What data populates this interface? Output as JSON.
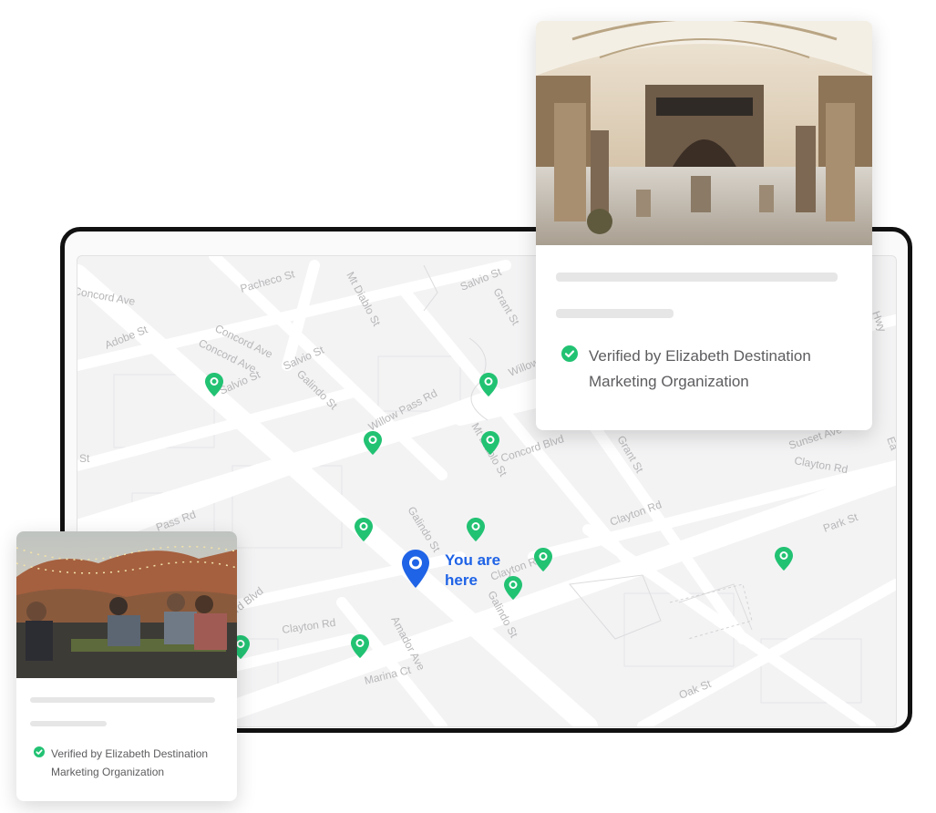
{
  "map": {
    "streets": [
      "Concord Ave",
      "Pacheco St",
      "Mt Diablo St",
      "Salvio St",
      "Grant St",
      "Adobe St",
      "Concord Ave",
      "Concord Ave",
      "Salvio St",
      "Salvio St",
      "Galindo St",
      "Willow Pass Rd",
      "Willow Pass Rd",
      "Mt Diablo St",
      "Concord Blvd",
      "Grant St",
      "Sunset Ave",
      "Clayton Rd",
      "Pass Rd",
      "Galindo St",
      "Clayton Rd",
      "Clayton Rd",
      "Park St",
      "ord Blvd",
      "Clayton Rd",
      "Galindo St",
      "Amador Ave",
      "Marina Ct",
      "Oak St",
      "St",
      "Hwy",
      "Ea"
    ],
    "you_are_here": "You are\nhere"
  },
  "featured_card": {
    "verified_text": "Verified by Elizabeth Destination Marketing  Organization"
  },
  "small_card": {
    "verified_text": "Verified by Elizabeth Destination Marketing  Organization"
  },
  "colors": {
    "accent_green": "#22c273",
    "you_blue": "#1f63e6",
    "frame": "#111111"
  },
  "icons": [
    "map-pin-icon",
    "location-pin-icon",
    "verified-check-icon"
  ]
}
